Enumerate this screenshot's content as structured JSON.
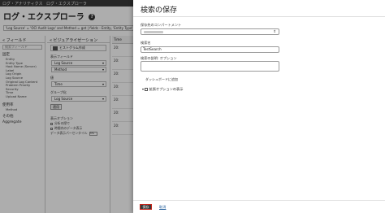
{
  "app": {
    "breadcrumbs": [
      "ログ・アナリティクス",
      "ログ・エクスプローラ"
    ],
    "page_title": "ログ・エクスプローラ",
    "help_icon": "?",
    "query": "'Log Source' = 'OCI Audit Logs' and Method = get | fields - Entity, 'Entity Type', 'Host Name (Server)', Label, 'Log Origin', 'Problem Priority'"
  },
  "fields_panel": {
    "header": "フィールド",
    "search_placeholder": "検索フィールド",
    "pinned_title": "固定",
    "pinned_items": [
      "Entity",
      "Entity Type",
      "Host Name (Server)",
      "Label",
      "Log Origin",
      "Log Source",
      "Original Log Content",
      "Problem Priority",
      "Security",
      "Time",
      "Upload Name"
    ],
    "interesting_title": "使用率",
    "interesting_items": [
      "Method"
    ],
    "other_title": "その他",
    "aggregate_title": "Aggregate"
  },
  "viz_panel": {
    "header": "ビジュアライゼーション",
    "chart_type": "ヒストグラム作成",
    "field_label": "表示フィールド",
    "fields": [
      "Log Source",
      "Method"
    ],
    "value_label": "値",
    "value": "Time",
    "group_label": "グループ化",
    "group": "Log Source",
    "apply": "適用",
    "options_label": "表示オプション",
    "options": [
      "分析の際で",
      "時間内のデータ表示"
    ],
    "percent_row_label": "データ表示パーセンタイル",
    "percent_value": "5%"
  },
  "table": {
    "header": "Time",
    "rows": [
      "20:",
      "20:",
      "20:",
      "20:",
      "20:",
      "20:",
      "20:"
    ]
  },
  "drawer": {
    "title": "検索の保存",
    "compartment_label": "保存先のコンパートメント",
    "search_name_label": "検索名",
    "search_name_value": "TestSearch",
    "description_label": "検索の説明: オプション",
    "dashboard_label": "ダッシュボードに追加",
    "advanced_label": "拡張オプションの表示",
    "save_button": "保存",
    "cancel_link": "取消"
  },
  "colors": {
    "save_button_bg": "#3a3a3a",
    "save_button_border": "#c6241a",
    "link": "#1d5a98"
  }
}
